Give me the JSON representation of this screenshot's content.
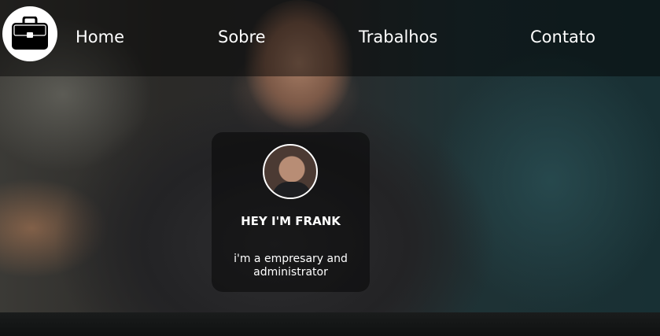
{
  "nav": {
    "logo_icon": "briefcase-icon",
    "links": [
      "Home",
      "Sobre",
      "Trabalhos",
      "Contato"
    ]
  },
  "profile": {
    "avatar_icon": "profile-photo",
    "title": "HEY I'M FRANK",
    "description": "i'm a empresary and administrator"
  },
  "colors": {
    "text": "#ffffff",
    "overlay": "rgba(0,0,0,0.45)"
  }
}
